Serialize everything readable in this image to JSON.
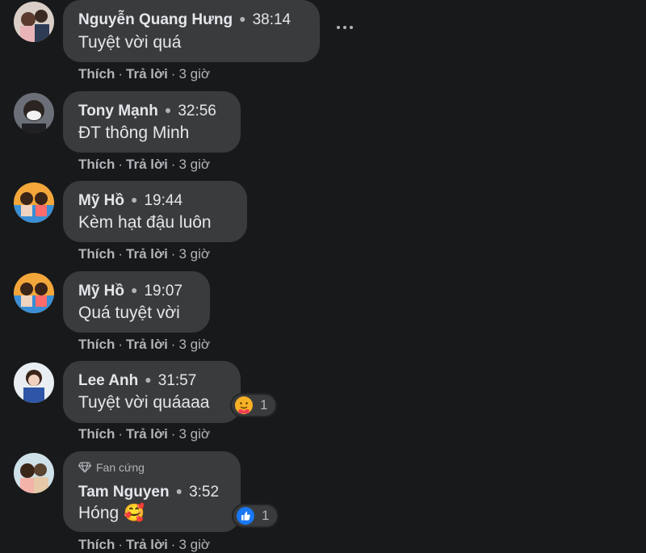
{
  "actions": {
    "like": "Thích",
    "reply": "Trả lời",
    "sep": "·",
    "time": "3 giờ"
  },
  "comments": [
    {
      "name": "Nguyễn Quang Hưng",
      "timestamp": "38:14",
      "text": "Tuyệt vời quá"
    },
    {
      "name": "Tony Mạnh",
      "timestamp": "32:56",
      "text": "ĐT thông Minh"
    },
    {
      "name": "Mỹ Hồ",
      "timestamp": "19:44",
      "text": "Kèm hạt đậu luôn"
    },
    {
      "name": "Mỹ Hồ",
      "timestamp": "19:07",
      "text": "Quá tuyệt vời"
    },
    {
      "name": "Lee Anh",
      "timestamp": "31:57",
      "text": "Tuyệt vời quáaaa",
      "reaction": {
        "icon": "care-reaction-icon",
        "count": "1"
      }
    },
    {
      "name": "Tam Nguyen",
      "badge": "Fan cứng",
      "timestamp": "3:52",
      "text": "Hóng",
      "emoji": "🥰",
      "reaction": {
        "icon": "like-reaction-icon",
        "count": "1"
      }
    }
  ],
  "colors": {
    "background": "#18191a",
    "bubble": "#3a3b3c",
    "like_blue": "#1877f2",
    "muted": "#b0b3b8"
  }
}
